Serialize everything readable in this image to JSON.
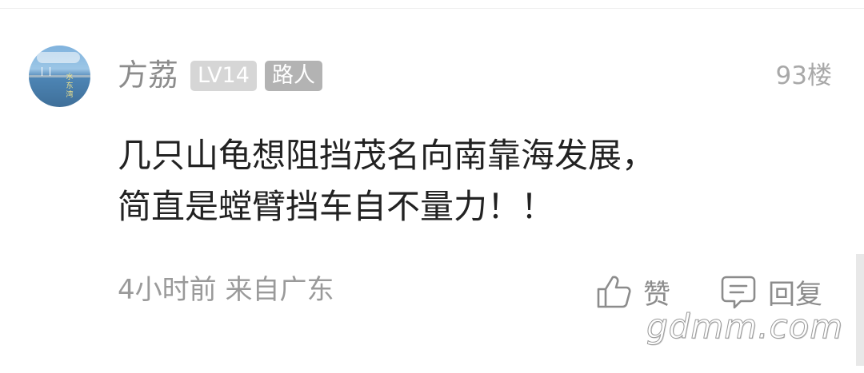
{
  "comment": {
    "username": "方荔",
    "level_badge": "LV14",
    "role_badge": "路人",
    "floor": "93楼",
    "avatar_text": "水东湾",
    "lines": [
      "几只山龟想阻挡茂名向南靠海发展，",
      "简直是螳臂挡车自不量力！！"
    ],
    "meta": "4小时前 来自广东",
    "like_label": "赞",
    "reply_label": "回复"
  },
  "watermark": "gdmm.com",
  "icons": {
    "like": "thumbs-up-icon",
    "reply": "comment-bubble-icon"
  },
  "colors": {
    "text_primary": "#222222",
    "text_secondary": "#9a9a9a",
    "badge_level": "#d6d6d6",
    "badge_role": "#b3b3b3"
  }
}
